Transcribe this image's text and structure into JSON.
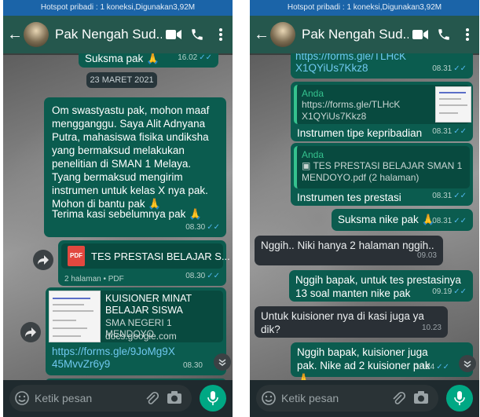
{
  "status_bar": "Hotspot pribadi : 1 koneksi,Digunakan3,92M",
  "contact_name": "Pak Nengah Sud...",
  "input_placeholder": "Ketik pesan",
  "left": {
    "top_message": {
      "text": "Suksma pak 🙏",
      "time": "16.02"
    },
    "date_divider": "23 MARET 2021",
    "long_message": {
      "paragraph": "Om swastyastu pak,  mohon maaf mengganggu. Saya Alit Adnyana Putra,  mahasiswa fisika undiksha yang bermaksud melakukan penelitian di SMAN 1 Melaya. Tyang bermaksud mengirim instrumen untuk kelas X nya pak.  Mohon di bantu pak 🙏",
      "closing": "Terima kasi sebelumnya pak 🙏",
      "time": "08.30"
    },
    "pdf_message": {
      "badge": "PDF",
      "title": "TES PRESTASI BELAJAR S...",
      "meta": "2 halaman • PDF",
      "time": "08.30"
    },
    "link_message": {
      "preview_title": "KUISIONER MINAT BELAJAR SISWA",
      "preview_subtitle": "SMA NEGERI 1 MENDOYO",
      "preview_domain": "docs.google.com",
      "url": "https://forms.gle/9JoMg9X45MvvZr6y9",
      "time": "08.30"
    }
  },
  "right": {
    "url_message": {
      "url": "https://forms.gle/TLHcKX1QYiUs7Kkz8",
      "time": "08.31"
    },
    "reply_message_1": {
      "quote_author": "Anda",
      "quote_text": "https://forms.gle/TLHcKX1QYiUs7Kkz8",
      "text": "Instrumen tipe kepribadian",
      "time": "08.31"
    },
    "reply_message_2": {
      "quote_author": "Anda",
      "quote_text": "▣ TES PRESTASI BELAJAR SMAN 1 MENDOYO.pdf (2 halaman)",
      "text": "Instrumen tes prestasi",
      "time": "08.31"
    },
    "suksma": {
      "text": "Suksma nike pak 🙏",
      "time": "08.31"
    },
    "incoming_1": {
      "text": "Nggih.. Niki hanya 2 halaman nggih..",
      "time": "09.03"
    },
    "outgoing_1": {
      "text": "Nggih bapak,  untuk tes prestasinya 13 soal manten nike pak",
      "time": "09.19"
    },
    "incoming_2": {
      "text": "Untuk kuisioner nya di kasi juga ya dik?",
      "time": "10.23"
    },
    "outgoing_2": {
      "text": "Nggih bapak,  kuisioner juga pak. Nike ad 2 kuisioner pak 🙏",
      "time": "10.24"
    }
  },
  "colors": {
    "header": "#25574d",
    "outgoing_bubble": "#0b5c4f",
    "incoming_bubble": "#2a3036",
    "status_bar": "#1b64a8",
    "read_tick": "#4fb6ec",
    "mic_button": "#00a884"
  },
  "icons": [
    "back-arrow-icon",
    "video-call-icon",
    "phone-icon",
    "more-vert-icon",
    "forward-icon",
    "pdf-icon",
    "scroll-down-icon",
    "emoji-icon",
    "attach-icon",
    "camera-icon",
    "mic-icon"
  ]
}
